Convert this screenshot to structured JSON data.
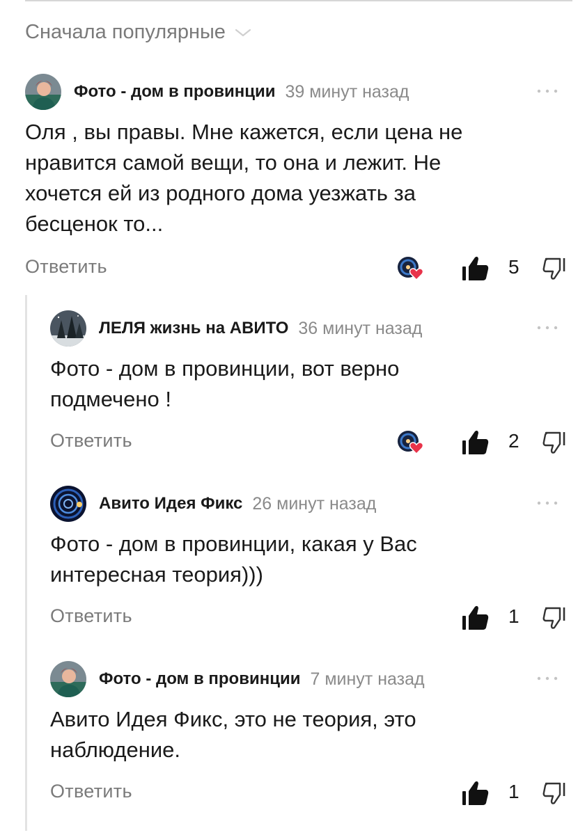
{
  "sort": {
    "label": "Сначала популярные",
    "icon": "chevron-down-icon"
  },
  "comments": [
    {
      "author": "Фото - дом в провинции",
      "time": "39 минут назад",
      "lines": [
        "Оля , вы правы. Мне кажется, если цена не",
        "нравится самой вещи, то она и лежит. Не",
        "хочется ей из родного дома уезжать за",
        "бесценок то..."
      ],
      "reply_label": "Ответить",
      "likes": "5",
      "author_liked": true
    },
    {
      "author": "ЛЕЛЯ жизнь на АВИТО",
      "time": "36 минут назад",
      "lines": [
        "Фото - дом в провинции, вот верно",
        "подмечено !"
      ],
      "reply_label": "Ответить",
      "likes": "2",
      "author_liked": true
    },
    {
      "author": "Авито Идея Фикс",
      "time": "26 минут назад",
      "lines": [
        "Фото - дом в провинции, какая у Вас",
        "интересная теория)))"
      ],
      "reply_label": "Ответить",
      "likes": "1",
      "author_liked": false
    },
    {
      "author": "Фото - дом в провинции",
      "time": "7 минут назад",
      "lines": [
        "Авито Идея Фикс, это не теория, это",
        "наблюдение."
      ],
      "reply_label": "Ответить",
      "likes": "1",
      "author_liked": false
    }
  ],
  "icons": [
    "more-icon",
    "like-icon",
    "dislike-icon",
    "heart-icon"
  ],
  "colors": {
    "text": "#1a1a1a",
    "muted": "#7a7a7a",
    "heart": "#e8334a",
    "divider": "#e3e3e3"
  }
}
